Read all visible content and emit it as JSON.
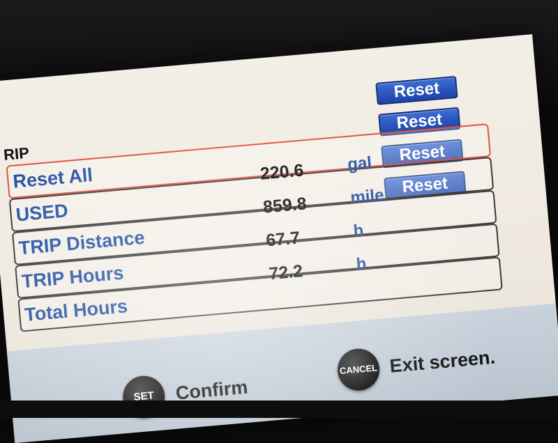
{
  "screen_title": "RIP",
  "rows": [
    {
      "label": "Reset All",
      "value": "220.6",
      "unit": "gal",
      "reset_label": "Reset",
      "selected": true
    },
    {
      "label": "USED",
      "value": "859.8",
      "unit": "mile",
      "reset_label": "Reset"
    },
    {
      "label": "TRIP Distance",
      "value": "67.7",
      "unit": "h",
      "reset_label": "Reset"
    },
    {
      "label": "TRIP Hours",
      "value": "72.2",
      "unit": "h",
      "reset_label": "Reset"
    },
    {
      "label": "Total Hours"
    }
  ],
  "softkeys": {
    "set": {
      "key": "SET",
      "text": "Confirm"
    },
    "cancel": {
      "key": "CANCEL",
      "text": "Exit screen."
    }
  },
  "colors": {
    "label_blue": "#2a55a5",
    "button_blue": "#1d43a8",
    "selected_border": "#e0523c"
  }
}
